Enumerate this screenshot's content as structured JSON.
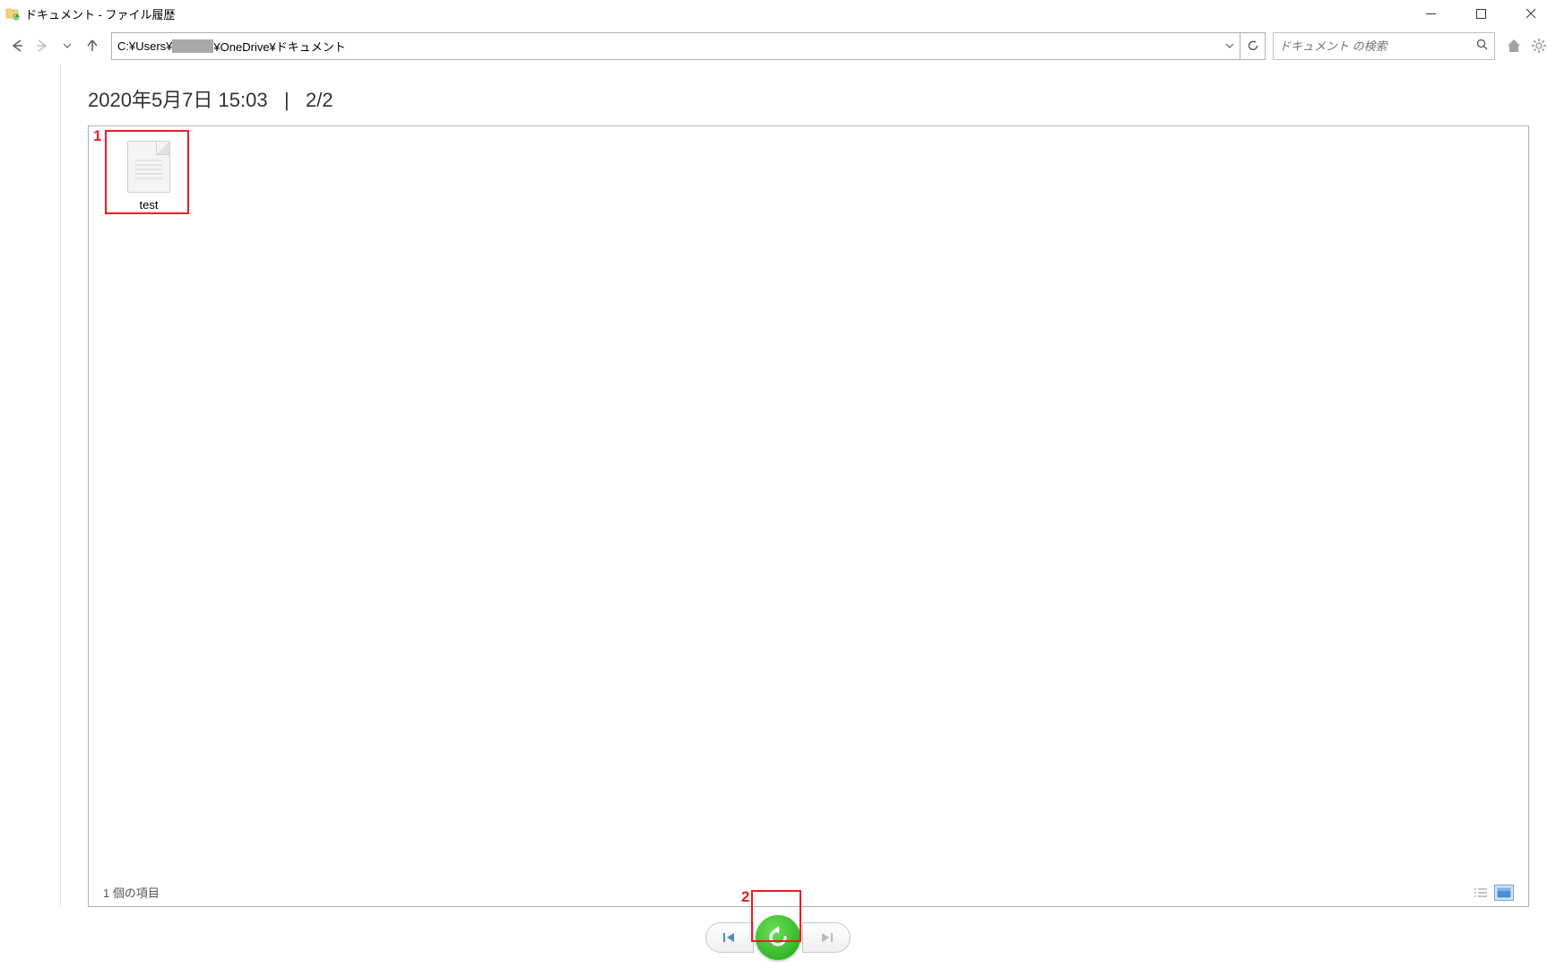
{
  "window": {
    "title": "ドキュメント - ファイル履歴"
  },
  "toolbar": {
    "path_prefix": "C:¥Users¥",
    "path_suffix": "¥OneDrive¥ドキュメント",
    "search_placeholder": "ドキュメント の検索"
  },
  "header": {
    "datetime": "2020年5月7日 15:03",
    "separator": "|",
    "page": "2/2"
  },
  "files": [
    {
      "name": "test"
    }
  ],
  "status": {
    "item_count": "1 個の項目"
  },
  "annotations": {
    "a1": "1",
    "a2": "2"
  }
}
